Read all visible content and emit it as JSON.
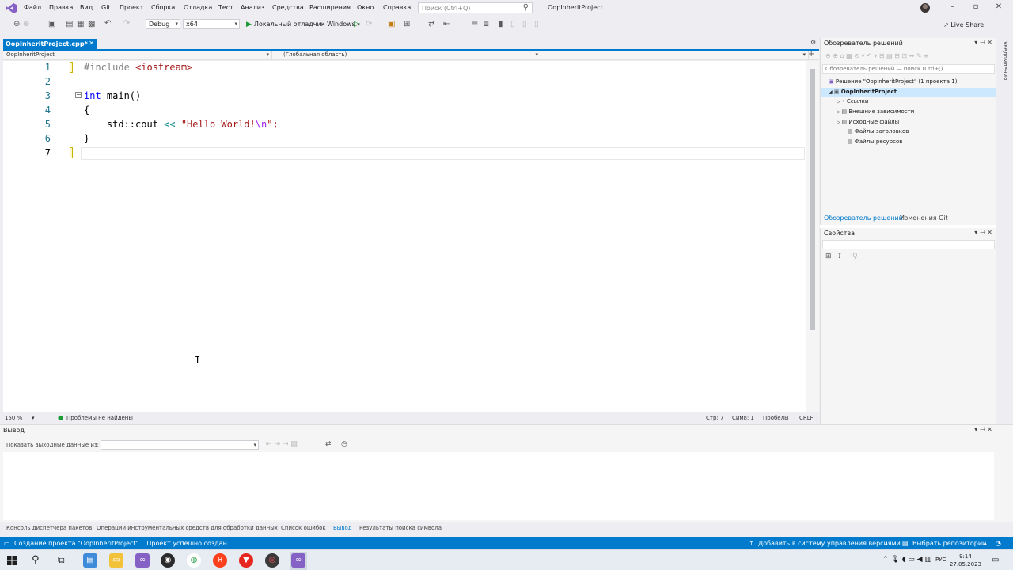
{
  "menu": {
    "items": [
      "Файл",
      "Правка",
      "Вид",
      "Git",
      "Проект",
      "Сборка",
      "Отладка",
      "Тест",
      "Анализ",
      "Средства",
      "Расширения",
      "Окно",
      "Справка"
    ],
    "search_placeholder": "Поиск (Ctrl+Q)",
    "project_title": "OopInheritProject"
  },
  "toolbar": {
    "config": "Debug",
    "platform": "x64",
    "run_label": "Локальный отладчик Windows",
    "live_share": "Live Share"
  },
  "document": {
    "tab_title": "OopInheritProject.cpp*",
    "nav_project": "OopInheritProject",
    "nav_scope": "(Глобальная область)",
    "lines": [
      "1",
      "2",
      "3",
      "4",
      "5",
      "6",
      "7"
    ],
    "code": {
      "include_kw": "#include",
      "include_file": "<iostream>",
      "int_kw": "int",
      "main_sig": " main()",
      "open_brace": "{",
      "cout": "    std::cout ",
      "shift_op": "<<",
      "str_start": " \"Hello World!",
      "esc": "\\n",
      "str_end": "\";",
      "close_brace": "}"
    }
  },
  "editor_status": {
    "zoom": "150 %",
    "problems": "Проблемы не найдены",
    "line": "Стр: 7",
    "col": "Симв: 1",
    "spaces": "Пробелы",
    "eol": "CRLF"
  },
  "solution_explorer": {
    "title": "Обозреватель решений",
    "search_placeholder": "Обозреватель решений — поиск (Ctrl+;)",
    "solution": "Решение \"OopInheritProject\" (1 проекта 1)",
    "project": "OopInheritProject",
    "nodes": [
      "Ссылки",
      "Внешние зависимости",
      "Исходные файлы",
      "Файлы заголовков",
      "Файлы ресурсов"
    ],
    "tab_solution": "Обозреватель решений",
    "tab_git": "Изменения Git"
  },
  "properties": {
    "title": "Свойства"
  },
  "right_strip": {
    "label": "Уведомления"
  },
  "output": {
    "title": "Вывод",
    "show_from": "Показать выходные данные из:"
  },
  "bottom_tabs": [
    "Консоль диспетчера пакетов",
    "Операции инструментальных средств для обработки данных",
    "Список ошибок",
    "Вывод",
    "Результаты поиска символа"
  ],
  "status": {
    "message": "Создание проекта \"OopInheritProject\"... Проект успешно создан.",
    "git_add": "Добавить в систему управления версиями",
    "repo": "Выбрать репозиторий"
  },
  "taskbar": {
    "lang": "РУС",
    "time": "9:14",
    "date": "27.05.2023",
    "yandex_letter": "Я"
  },
  "colors": {
    "accent": "#007acc",
    "chrome": "#eeeef2",
    "keyword": "#0000ff",
    "string": "#a31515"
  }
}
